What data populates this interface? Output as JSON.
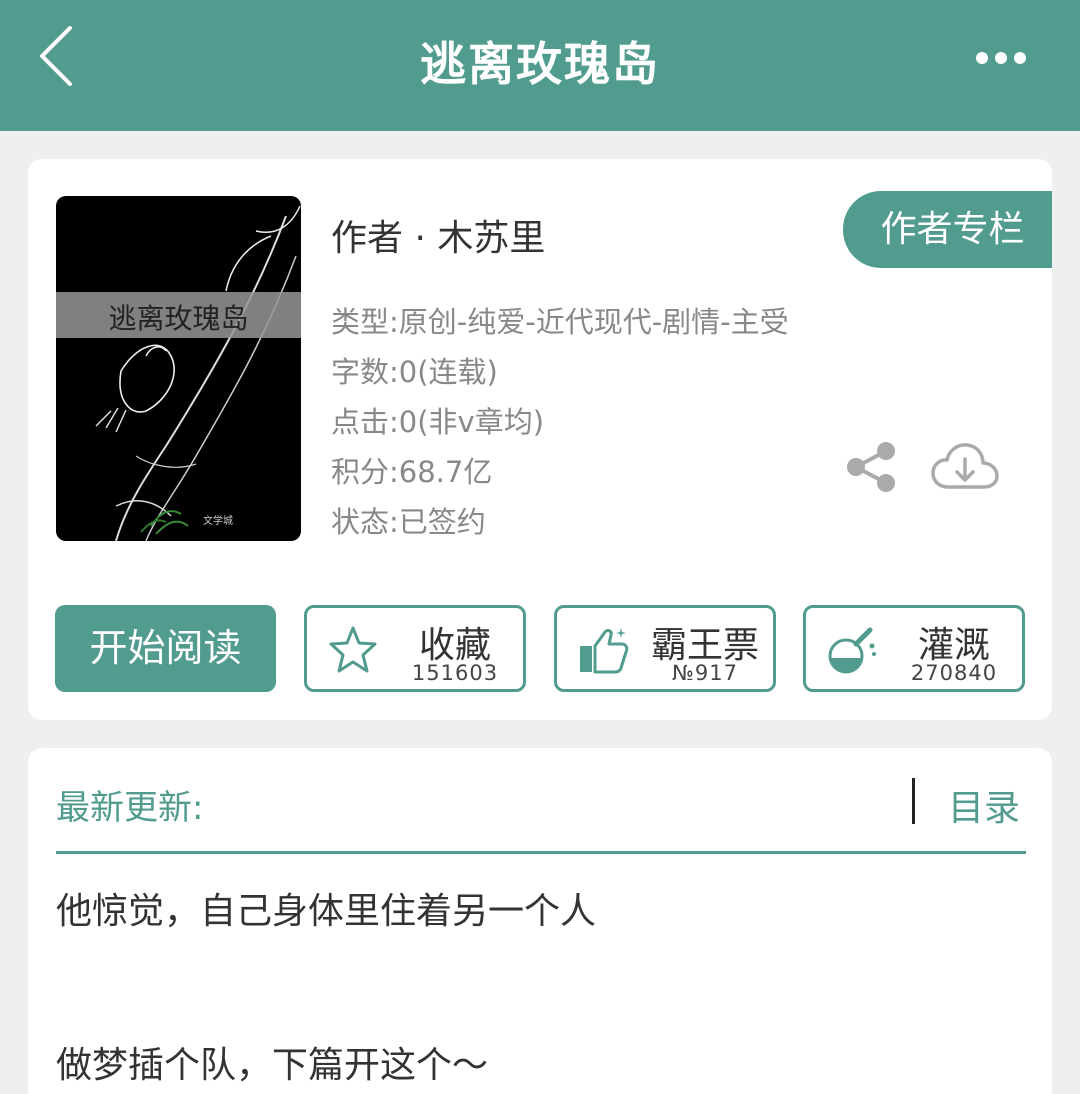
{
  "header": {
    "title": "逃离玫瑰岛",
    "back_icon": "chevron-left-icon",
    "more_icon": "more-dots-icon",
    "color": "#519c8f"
  },
  "book": {
    "cover_title": "逃离玫瑰岛",
    "cover_watermark": "文学城",
    "author": "作者 · 木苏里",
    "author_column_label": "作者专栏",
    "type": "类型:原创-纯爱-近代现代-剧情-主受",
    "words": "字数:0(连载)",
    "clicks": "点击:0(非v章均)",
    "score": "积分:68.7亿",
    "status": "状态:已签约"
  },
  "actions": {
    "read_label": "开始阅读",
    "favorite": {
      "label": "收藏",
      "count": "151603",
      "icon": "star-icon"
    },
    "vote": {
      "label": "霸王票",
      "count": "№917",
      "icon": "thumbs-up-icon"
    },
    "water": {
      "label": "灌溉",
      "count": "270840",
      "icon": "flask-icon"
    },
    "share_icon": "share-icon",
    "download_icon": "cloud-download-icon"
  },
  "latest": {
    "label": "最新更新:",
    "toc_label": "目录",
    "lines": [
      "他惊觉，自己身体里住着另一个人",
      "做梦插个队，下篇开这个～"
    ]
  }
}
